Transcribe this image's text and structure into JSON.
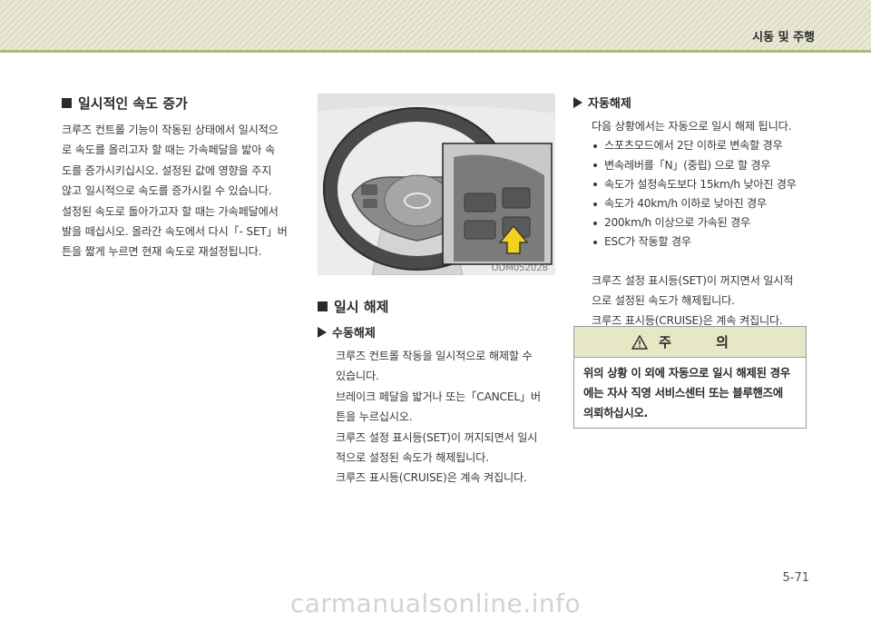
{
  "header": {
    "title": "시동 및 주행"
  },
  "left": {
    "heading": "일시적인 속도 증가",
    "lines": [
      "크루즈 컨트롤 기능이 작동된 상태에서 일시적으",
      "로 속도를 올리고자 할 때는 가속페달을 밟아 속",
      "도를 증가시키십시오. 설정된 값에 영향을 주지",
      "않고 일시적으로 속도를 증가시킬 수 있습니다.",
      "설정된 속도로 돌아가고자 할 때는 가속페달에서",
      "발을 떼십시오. 올라간 속도에서 다시「- SET」버",
      "튼을 짧게 누르면 현재 속도로 재설정됩니다."
    ]
  },
  "figure": {
    "code": "ODM052028"
  },
  "mid": {
    "heading": "일시 해제",
    "subheading": "수동해제",
    "lines": [
      "크루즈 컨트롤 작동을 일시적으로 해제할 수",
      "있습니다.",
      "브레이크 페달을 밟거나 또는「CANCEL」버",
      "튼을 누르십시오.",
      "크루즈 설정 표시등(SET)이 꺼지되면서 일시",
      "적으로 설정된 속도가 해제됩니다.",
      "크루즈 표시등(CRUISE)은 계속 켜집니다."
    ]
  },
  "right": {
    "subheading": "자동해제",
    "intro": "다음 상황에서는 자동으로 일시 해제 됩니다.",
    "bullets": [
      "스포츠모드에서 2단 이하로 변속할 경우",
      "변속레버를「N」(중립) 으로 할 경우",
      "속도가 설정속도보다 15km/h 낮아진 경우",
      "속도가 40km/h 이하로 낮아진 경우",
      "200km/h 이상으로 가속된 경우",
      "ESC가 작동할 경우"
    ],
    "after": [
      "크루즈 설정 표시등(SET)이 꺼지면서 일시적",
      "으로 설정된 속도가 해제됩니다.",
      "크루즈 표시등(CRUISE)은 계속 켜집니다."
    ]
  },
  "caution": {
    "title": "주 의",
    "lines": [
      "위의 상황 이 외에 자동으로 일시 해제된 경우",
      "에는 자사 직영 서비스센터 또는 블루핸즈에",
      "의뢰하십시오."
    ]
  },
  "page_number": "5-71",
  "watermark": "carmanualsonline.info"
}
